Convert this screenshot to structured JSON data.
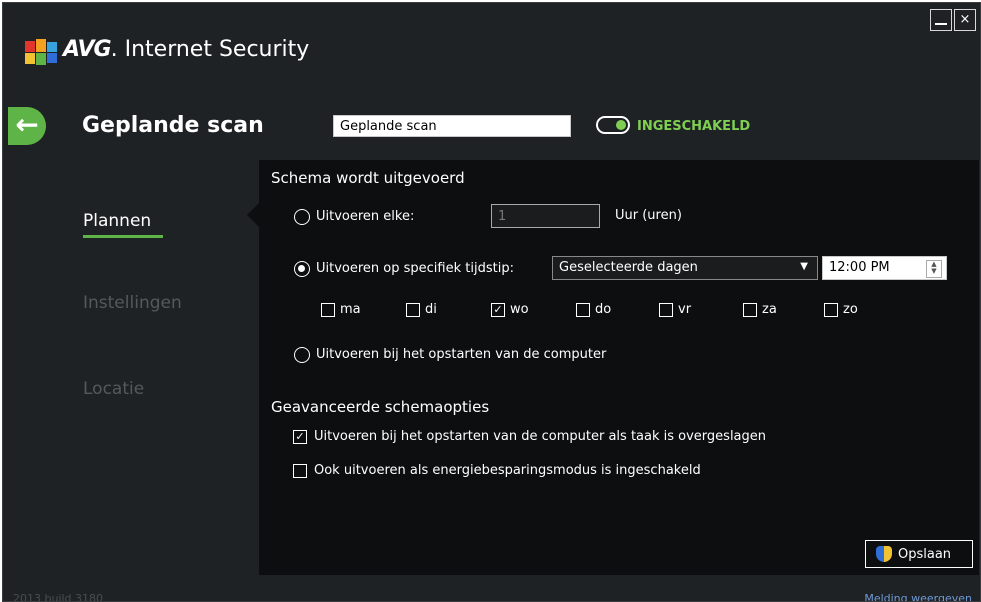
{
  "app": {
    "brand_bold": "AVG",
    "brand_rest": ". Internet Security"
  },
  "window_controls": {
    "minimize": "_",
    "close": "×"
  },
  "header": {
    "title": "Geplande scan",
    "name_value": "Geplande scan",
    "toggle_label": "INGESCHAKELD",
    "toggle_on": true
  },
  "nav": {
    "items": [
      {
        "label": "Plannen",
        "active": true
      },
      {
        "label": "Instellingen",
        "active": false
      },
      {
        "label": "Locatie",
        "active": false
      }
    ]
  },
  "schedule": {
    "section_title": "Schema wordt uitgevoerd",
    "run_every_label": "Uitvoeren elke:",
    "run_every_value": "1",
    "run_every_unit": "Uur (uren)",
    "specific_time_label": "Uitvoeren op specifiek tijdstip:",
    "specific_time_selected": true,
    "days_select_value": "Geselecteerde dagen",
    "time_value": "12:00 PM",
    "days": [
      {
        "label": "ma",
        "checked": false
      },
      {
        "label": "di",
        "checked": false
      },
      {
        "label": "wo",
        "checked": true
      },
      {
        "label": "do",
        "checked": false
      },
      {
        "label": "vr",
        "checked": false
      },
      {
        "label": "za",
        "checked": false
      },
      {
        "label": "zo",
        "checked": false
      }
    ],
    "on_startup_label": "Uitvoeren bij het opstarten van de computer"
  },
  "advanced": {
    "section_title": "Geavanceerde schemaopties",
    "options": [
      {
        "label": "Uitvoeren bij het opstarten van de computer als taak is overgeslagen",
        "checked": true
      },
      {
        "label": "Ook uitvoeren als energiebesparingsmodus is ingeschakeld",
        "checked": false
      }
    ]
  },
  "actions": {
    "save_label": "Opslaan"
  },
  "footer": {
    "build": "2013  build 3180",
    "notification_link": "Melding weergeven"
  },
  "colors": {
    "accent_green": "#5eb447",
    "toggle_green": "#7fcf52",
    "link_blue": "#6f9ad6",
    "panel_bg": "#0c0e0f",
    "window_bg": "#1f2224"
  }
}
